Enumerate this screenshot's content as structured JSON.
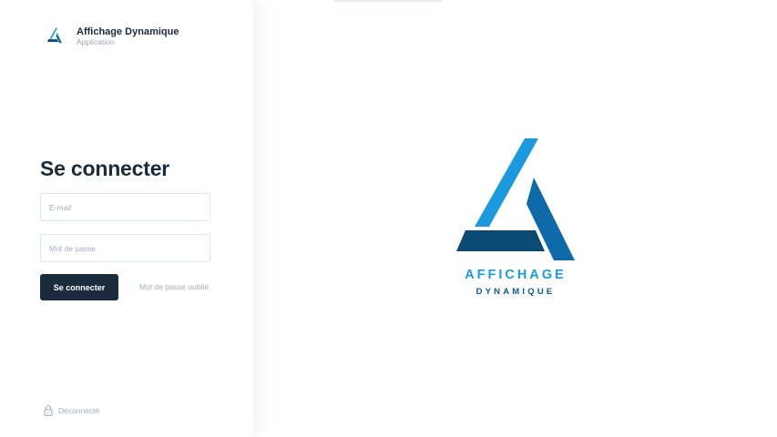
{
  "brand": {
    "title": "Affichage Dynamique",
    "subtitle": "Application",
    "logo_icon": "triangle-a-logo-icon"
  },
  "login": {
    "title": "Se connecter",
    "email_placeholder": "E-mail",
    "password_placeholder": "Mot de passe",
    "submit_label": "Se connecter",
    "forgot_label": "Mot de passe oublié"
  },
  "status": {
    "icon": "lock-icon",
    "text": "Déconnecté"
  },
  "hero": {
    "line1": "AFFICHAGE",
    "line2": "DYNAMIQUE"
  },
  "colors": {
    "navy": "#1b2a3d",
    "logo_light_blue": "#1c9ae0",
    "logo_mid_blue": "#0e6aa8",
    "logo_dark_blue": "#0b4a73",
    "muted_text": "#a3aebd"
  }
}
